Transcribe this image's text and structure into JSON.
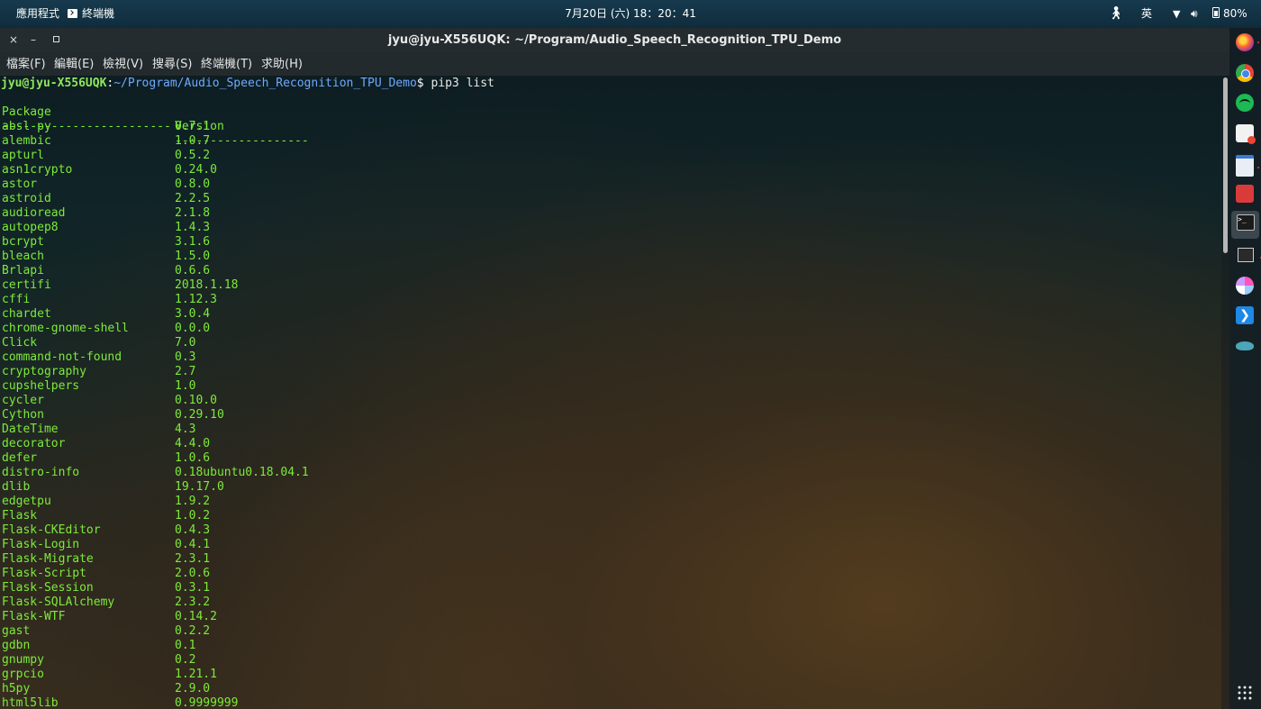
{
  "topbar": {
    "apps_menu": "應用程式",
    "active_app": "終端機",
    "clock": "7月20日 (六) 18：20：41",
    "ime": "英",
    "battery": "80%"
  },
  "window": {
    "title": "jyu@jyu-X556UQK: ~/Program/Audio_Speech_Recognition_TPU_Demo",
    "close": "×",
    "minimize": "–"
  },
  "menubar": {
    "items": [
      "檔案(F)",
      "編輯(E)",
      "檢視(V)",
      "搜尋(S)",
      "終端機(T)",
      "求助(H)"
    ]
  },
  "terminal": {
    "prompt_user": "jyu@jyu-X556UQK",
    "prompt_sep": ":",
    "prompt_path": "~/Program/Audio_Speech_Recognition_TPU_Demo",
    "prompt_end": "$ ",
    "command": "pip3 list",
    "header_package": "Package",
    "header_version": "Version",
    "separator_package": "------------------------",
    "separator_version": "-------------------",
    "packages": [
      {
        "name": "absl-py",
        "version": "0.7.1"
      },
      {
        "name": "alembic",
        "version": "1.0.7"
      },
      {
        "name": "apturl",
        "version": "0.5.2"
      },
      {
        "name": "asn1crypto",
        "version": "0.24.0"
      },
      {
        "name": "astor",
        "version": "0.8.0"
      },
      {
        "name": "astroid",
        "version": "2.2.5"
      },
      {
        "name": "audioread",
        "version": "2.1.8"
      },
      {
        "name": "autopep8",
        "version": "1.4.3"
      },
      {
        "name": "bcrypt",
        "version": "3.1.6"
      },
      {
        "name": "bleach",
        "version": "1.5.0"
      },
      {
        "name": "Brlapi",
        "version": "0.6.6"
      },
      {
        "name": "certifi",
        "version": "2018.1.18"
      },
      {
        "name": "cffi",
        "version": "1.12.3"
      },
      {
        "name": "chardet",
        "version": "3.0.4"
      },
      {
        "name": "chrome-gnome-shell",
        "version": "0.0.0"
      },
      {
        "name": "Click",
        "version": "7.0"
      },
      {
        "name": "command-not-found",
        "version": "0.3"
      },
      {
        "name": "cryptography",
        "version": "2.7"
      },
      {
        "name": "cupshelpers",
        "version": "1.0"
      },
      {
        "name": "cycler",
        "version": "0.10.0"
      },
      {
        "name": "Cython",
        "version": "0.29.10"
      },
      {
        "name": "DateTime",
        "version": "4.3"
      },
      {
        "name": "decorator",
        "version": "4.4.0"
      },
      {
        "name": "defer",
        "version": "1.0.6"
      },
      {
        "name": "distro-info",
        "version": "0.18ubuntu0.18.04.1"
      },
      {
        "name": "dlib",
        "version": "19.17.0"
      },
      {
        "name": "edgetpu",
        "version": "1.9.2"
      },
      {
        "name": "Flask",
        "version": "1.0.2"
      },
      {
        "name": "Flask-CKEditor",
        "version": "0.4.3"
      },
      {
        "name": "Flask-Login",
        "version": "0.4.1"
      },
      {
        "name": "Flask-Migrate",
        "version": "2.3.1"
      },
      {
        "name": "Flask-Script",
        "version": "2.0.6"
      },
      {
        "name": "Flask-Session",
        "version": "0.3.1"
      },
      {
        "name": "Flask-SQLAlchemy",
        "version": "2.3.2"
      },
      {
        "name": "Flask-WTF",
        "version": "0.14.2"
      },
      {
        "name": "gast",
        "version": "0.2.2"
      },
      {
        "name": "gdbn",
        "version": "0.1"
      },
      {
        "name": "gnumpy",
        "version": "0.2"
      },
      {
        "name": "grpcio",
        "version": "1.21.1"
      },
      {
        "name": "h5py",
        "version": "2.9.0"
      },
      {
        "name": "html5lib",
        "version": "0.9999999"
      }
    ]
  },
  "dock": {
    "icons": [
      "firefox-icon",
      "chrome-icon",
      "spotify-icon",
      "software-center-icon",
      "files-icon",
      "toolbox-icon",
      "terminal-icon",
      "system-monitor-icon",
      "disks-icon",
      "vscode-icon",
      "mysql-workbench-icon",
      "app-grid-icon"
    ]
  },
  "colors": {
    "terminal_text": "#7dea3a",
    "prompt_path": "#6fa9ff",
    "topbar_bg": "#173a4e",
    "titlebar_bg": "#252c2f"
  }
}
